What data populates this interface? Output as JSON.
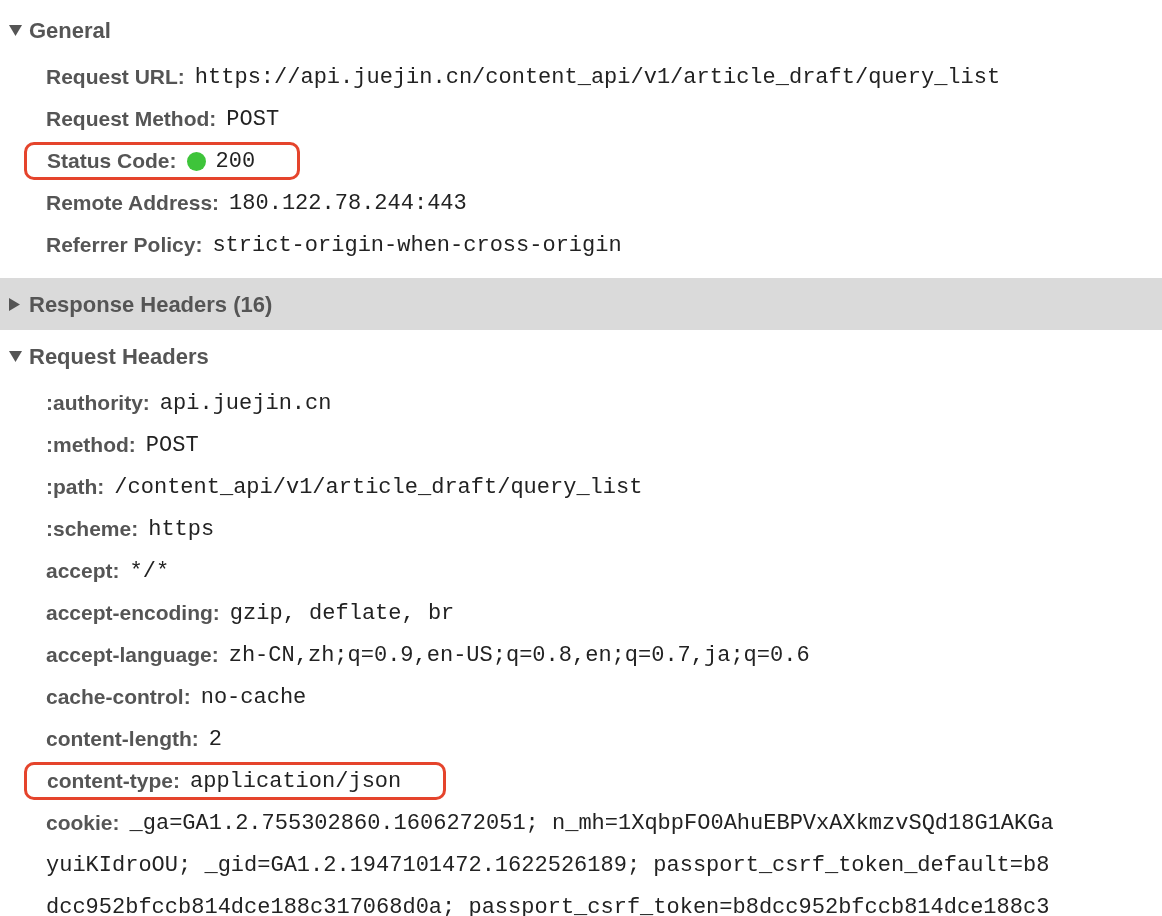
{
  "sections": [
    {
      "title": "General",
      "expanded": true,
      "selected": false,
      "rows": [
        {
          "name": "Request URL:",
          "value": "https://api.juejin.cn/content_api/v1/article_draft/query_list",
          "outlined": false
        },
        {
          "name": "Request Method:",
          "value": "POST",
          "outlined": false
        },
        {
          "name": "Status Code:",
          "value": "200",
          "outlined": true,
          "kind": "status",
          "color": "#3ec43a"
        },
        {
          "name": "Remote Address:",
          "value": "180.122.78.244:443",
          "outlined": false
        },
        {
          "name": "Referrer Policy:",
          "value": "strict-origin-when-cross-origin",
          "outlined": false
        }
      ]
    },
    {
      "title": "Response Headers (16)",
      "expanded": false,
      "selected": true
    },
    {
      "title": "Request Headers",
      "expanded": true,
      "selected": false,
      "rows": [
        {
          "name": ":authority:",
          "value": "api.juejin.cn",
          "outlined": false
        },
        {
          "name": ":method:",
          "value": "POST",
          "outlined": false
        },
        {
          "name": ":path:",
          "value": "/content_api/v1/article_draft/query_list",
          "outlined": false
        },
        {
          "name": ":scheme:",
          "value": "https",
          "outlined": false
        },
        {
          "name": "accept:",
          "value": "*/*",
          "outlined": false
        },
        {
          "name": "accept-encoding:",
          "value": "gzip, deflate, br",
          "outlined": false
        },
        {
          "name": "accept-language:",
          "value": "zh-CN,zh;q=0.9,en-US;q=0.8,en;q=0.7,ja;q=0.6",
          "outlined": false
        },
        {
          "name": "cache-control:",
          "value": "no-cache",
          "outlined": false
        },
        {
          "name": "content-length:",
          "value": "2",
          "outlined": false
        },
        {
          "name": "content-type:",
          "value": "application/json",
          "outlined": true
        },
        {
          "name": "cookie:",
          "value_lines": [
            "_ga=GA1.2.755302860.1606272051; n_mh=1XqbpFO0AhuEBPVxAXkmzvSQd18G1AKGa",
            "yuiKIdroOU; _gid=GA1.2.1947101472.1622526189; passport_csrf_token_default=b8",
            "dcc952bfccb814dce188c317068d0a; passport_csrf_token=b8dcc952bfccb814dce188c3"
          ],
          "outlined": false
        }
      ]
    }
  ]
}
